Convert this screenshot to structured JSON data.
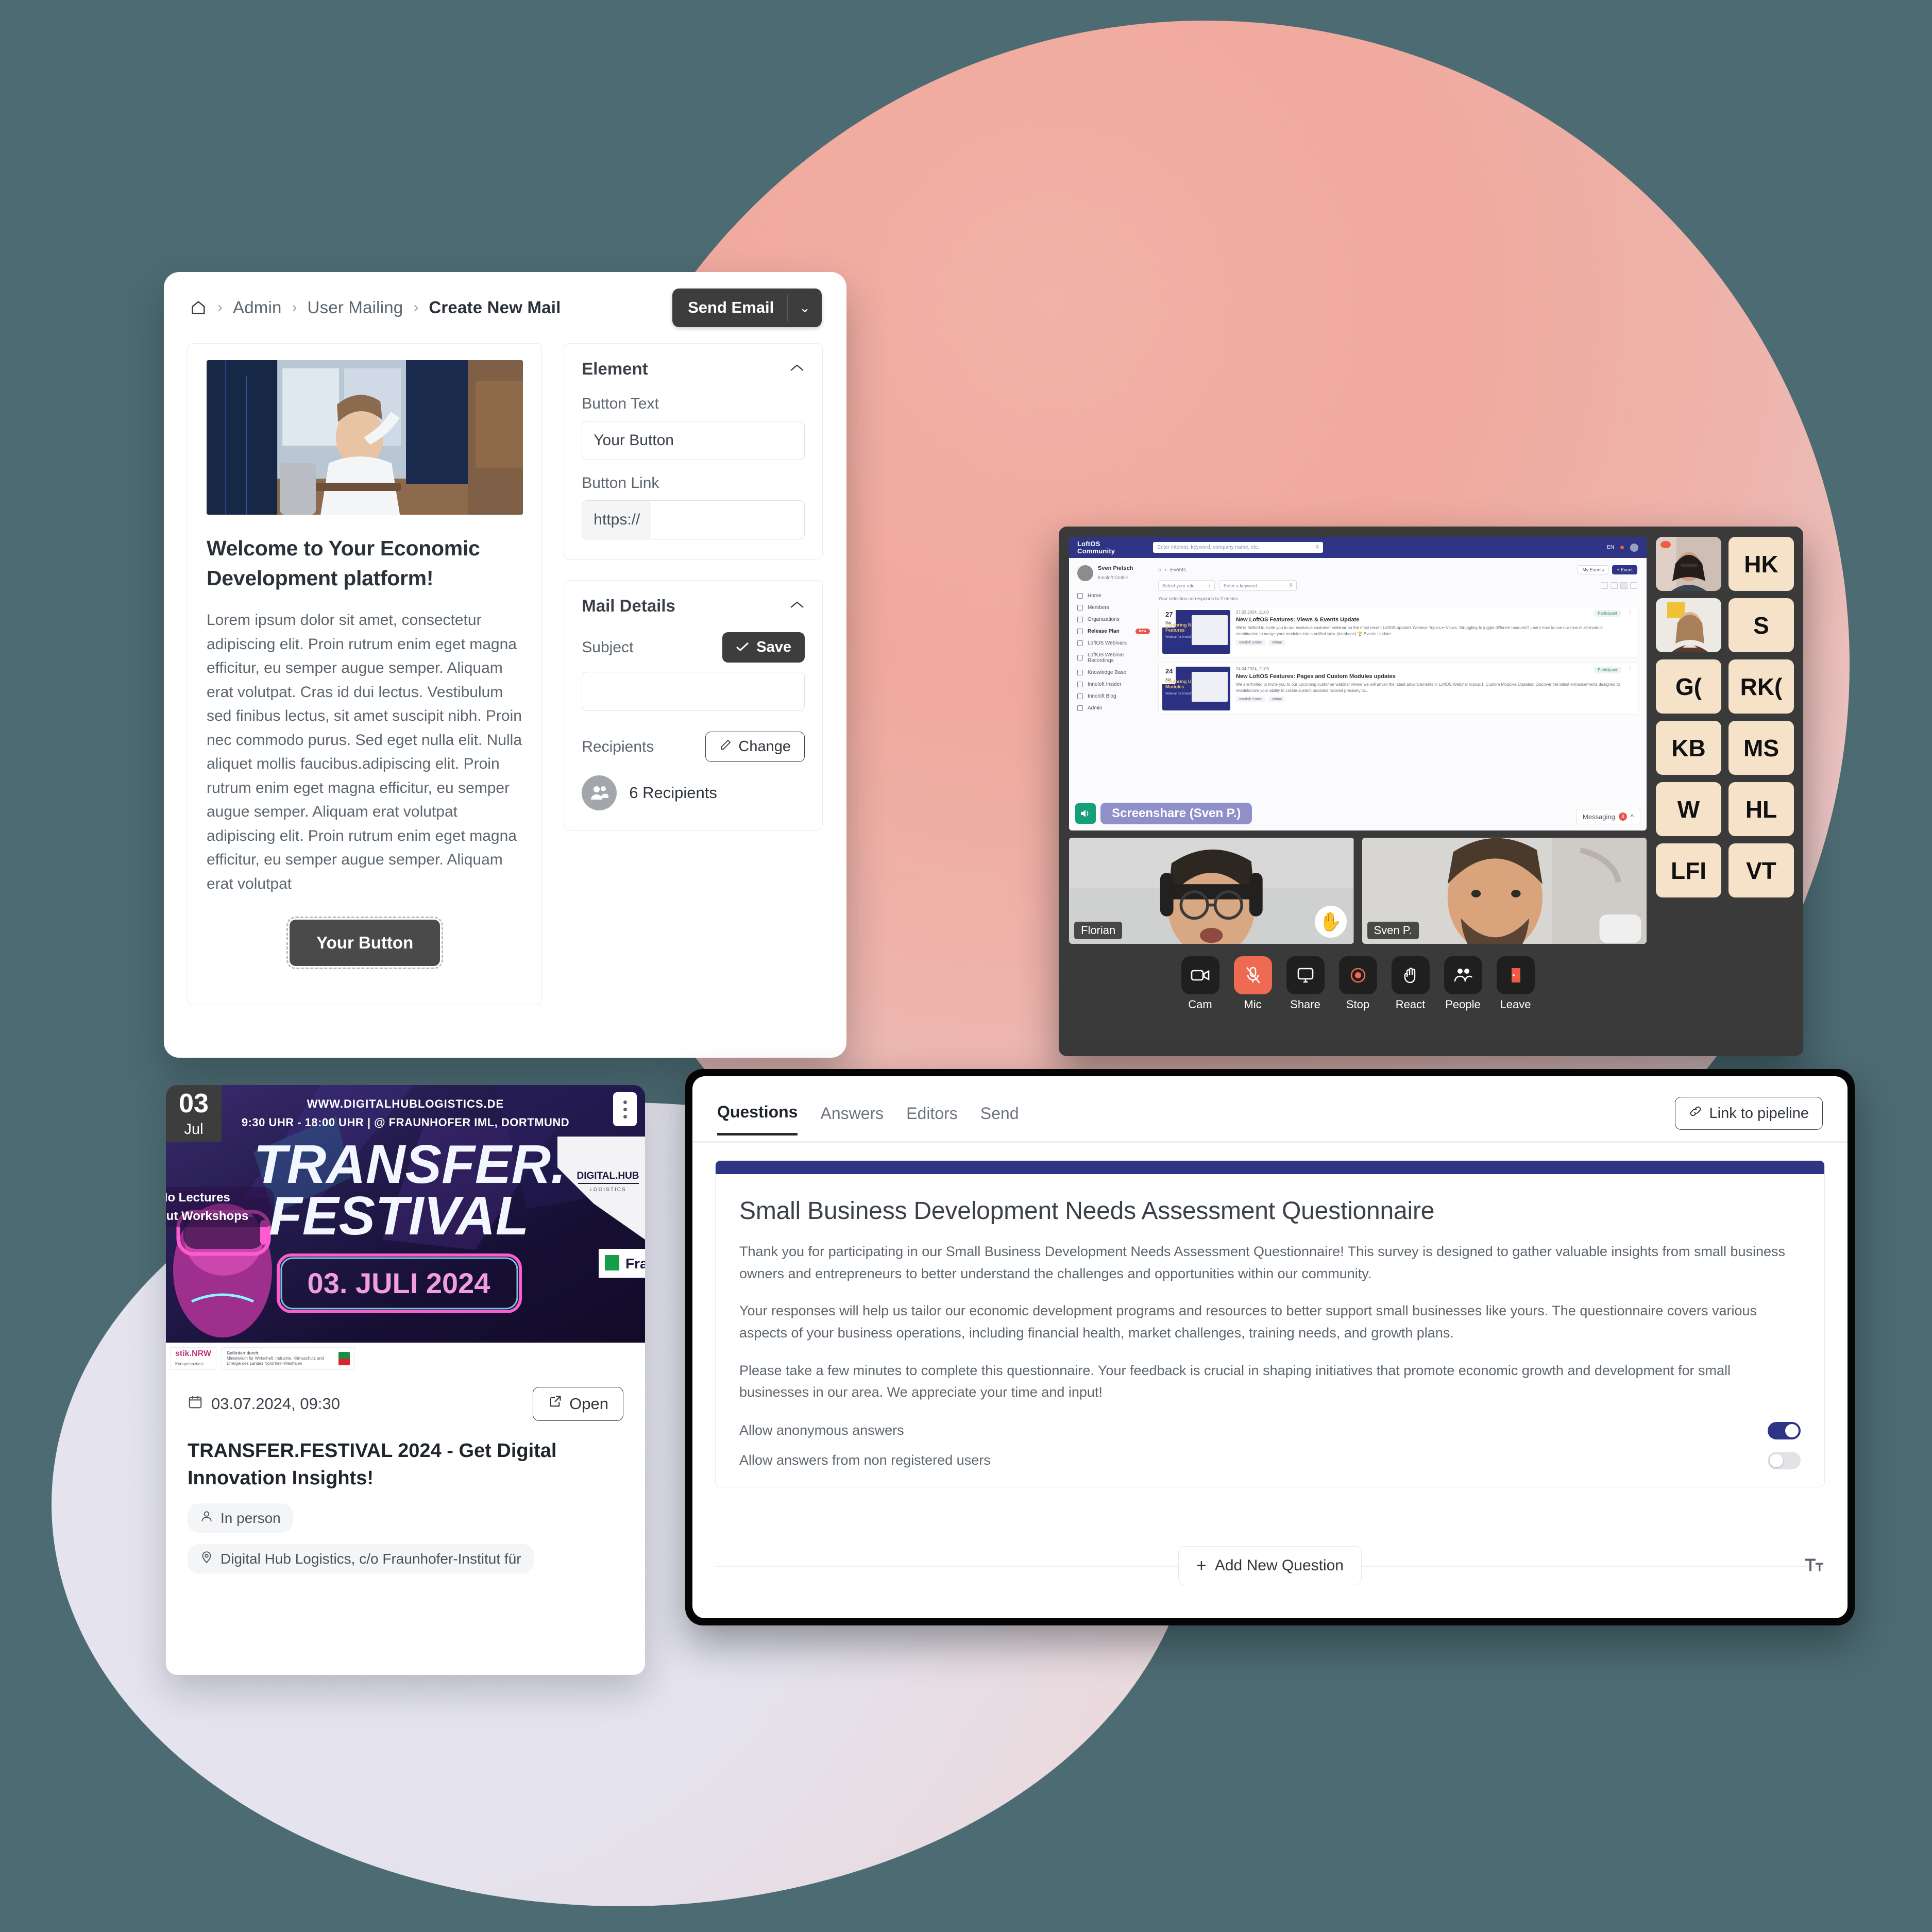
{
  "background": {
    "canvas_color": "#4d6b72",
    "blob_pink": "#f0a99d",
    "blob_lavender": "#e4e3ee"
  },
  "mail_window": {
    "breadcrumb": {
      "home_icon": "home-icon",
      "items": [
        "Admin",
        "User Mailing",
        "Create New Mail"
      ]
    },
    "send_button": {
      "label": "Send Email",
      "caret_icon": "chevron-down-icon"
    },
    "email_preview": {
      "heading": "Welcome to Your Economic Development platform!",
      "body": "Lorem ipsum dolor sit amet, consectetur adipiscing elit. Proin rutrum enim eget magna efficitur, eu semper augue semper. Aliquam erat volutpat. Cras id dui lectus. Vestibulum sed finibus lectus, sit amet suscipit nibh. Proin nec commodo purus. Sed eget nulla elit. Nulla aliquet mollis faucibus.adipiscing elit. Proin rutrum enim eget magna efficitur, eu semper augue semper. Aliquam erat volutpat adipiscing elit. Proin rutrum enim eget magna efficitur, eu semper augue semper. Aliquam erat volutpat",
      "cta_label": "Your Button"
    },
    "element_section": {
      "title": "Element",
      "collapse_icon": "chevron-up-icon",
      "button_text_label": "Button Text",
      "button_text_value": "Your Button",
      "button_link_label": "Button Link",
      "button_link_prefix": "https://",
      "button_link_value": ""
    },
    "mail_details_section": {
      "title": "Mail Details",
      "collapse_icon": "chevron-up-icon",
      "subject_label": "Subject",
      "subject_value": "",
      "save_label": "Save",
      "recipients_label": "Recipients",
      "change_label": "Change",
      "recipients_count": "6 Recipients"
    }
  },
  "video_call": {
    "screenshare": {
      "app_logo_line1": "LoftOS",
      "app_logo_line2": "Community",
      "search_placeholder": "Enter interest, keyword, company name, etc.",
      "lang": "EN",
      "user_name": "Sven Pietsch",
      "user_org": "Innoloft GmbH",
      "nav": [
        "Home",
        "Members",
        "Organizations",
        "Release Plan",
        "LoftOS Webinars",
        "LoftOS Webinar Recordings",
        "Knowledge Base",
        "Innoloft Insider",
        "Innoloft Blog",
        "Admin"
      ],
      "nav_active": "Release Plan",
      "nav_badge": "New",
      "breadcrumb": "Events",
      "my_events_label": "My Events",
      "add_event_label": "+ Event",
      "role_select_placeholder": "Select your role",
      "keyword_placeholder": "Enter a keyword...",
      "result_count_text": "Your selection corresponds to 2 entries",
      "events": [
        {
          "day": "27",
          "month": "Mar",
          "banner_title": "Exploring New LoftOS Features",
          "banner_sub": "Webinar for Innoloft customers",
          "date": "27.03.2024, 11:00",
          "status": "Participant",
          "title": "New LoftOS Features: Views & Events Update",
          "desc": "We're thrilled to invite you to our exclusive customer webinar on the most recent LoftOS updates.Webinar Topics:•• Views: Struggling to juggle different modules? Learn how to use our new multi-module combination to merge your modules into a unified view (database).🏆 Events Update:...",
          "tags": [
            "Innoloft GmbH",
            "Virtual"
          ]
        },
        {
          "day": "24",
          "month": "Apr",
          "banner_title": "Exploring Updated LoftOS Modules",
          "banner_sub": "Webinar for Innoloft customers",
          "date": "24.04.2024, 11:00",
          "status": "Participant",
          "title": "New LoftOS Features: Pages and Custom Modules updates",
          "desc": "We are thrilled to invite you to our upcoming customer webinar where we will unveil the latest advancements in LoftOS.Webinar topics:1. Custom Modules Updates: Discover the latest enhancements designed to revolutionize your ability to create custom modules tailored precisely to...",
          "tags": [
            "Innoloft GmbH",
            "Virtual"
          ]
        }
      ],
      "share_badge": "Screenshare (Sven P.)",
      "speaker_icon": "speaker-icon",
      "messaging_label": "Messaging",
      "messaging_count": "3"
    },
    "cam_tiles": [
      {
        "name": "Florian",
        "reaction": "✋"
      },
      {
        "name": "Sven P.",
        "reaction": ""
      }
    ],
    "controls": [
      {
        "label": "Cam",
        "icon": "camera-icon",
        "active": false
      },
      {
        "label": "Mic",
        "icon": "mic-muted-icon",
        "active": true
      },
      {
        "label": "Share",
        "icon": "screen-share-icon",
        "active": false
      },
      {
        "label": "Stop",
        "icon": "record-stop-icon",
        "active": false
      },
      {
        "label": "React",
        "icon": "raised-hand-icon",
        "active": false
      },
      {
        "label": "People",
        "icon": "people-icon",
        "active": false
      },
      {
        "label": "Leave",
        "icon": "leave-door-icon",
        "active": false
      }
    ],
    "participants": [
      "HK",
      "S",
      "G(",
      "RK(",
      "KB",
      "MS",
      "W",
      "HL",
      "LFI",
      "VT"
    ],
    "participant_accent": "#f6e2c8"
  },
  "event_card": {
    "date_day": "03",
    "date_month": "Jul",
    "banner": {
      "url": "WWW.DIGITALHUBLOGISTICS.DE",
      "time_place": "9:30 UHR - 18:00 UHR | @ FRAUNHOFER IML, DORTMUND",
      "title_line1": "TRANSFER.",
      "title_line2": "FESTIVAL",
      "date_badge": "03. JULI 2024",
      "sticker_line1": "No Lectures",
      "sticker_line2": "but Workshops",
      "logo_hub_line1": "DIGITAL.HUB",
      "logo_hub_line2": "LOGISTICS",
      "logo_fraunhofer": "Fra"
    },
    "logos": {
      "left_strong": "stik.NRW",
      "left_sub": "Kompetenznetz",
      "right_title": "Gefördert durch:",
      "right_text": "Ministerium für Wirtschaft, Industrie, Klimaschutz und Energie des Landes Nordrhein-Westfalen"
    },
    "datetime": "03.07.2024, 09:30",
    "calendar_icon": "calendar-icon",
    "open_label": "Open",
    "open_icon": "external-link-icon",
    "title": "TRANSFER.FESTIVAL 2024 - Get Digital Innovation Insights!",
    "chips": [
      {
        "icon": "person-icon",
        "label": "In person"
      },
      {
        "icon": "map-pin-icon",
        "label": "Digital Hub Logistics, c/o Fraunhofer-Institut für"
      }
    ]
  },
  "questionnaire": {
    "tabs": [
      "Questions",
      "Answers",
      "Editors",
      "Send"
    ],
    "active_tab": "Questions",
    "link_button": {
      "label": "Link to pipeline",
      "icon": "link-icon"
    },
    "accent_color": "#2f3584",
    "title": "Small Business Development Needs Assessment Questionnaire",
    "paragraphs": [
      "Thank you for participating in our Small Business Development Needs Assessment Questionnaire! This survey is designed to gather valuable insights from small business owners and entrepreneurs to better understand the challenges and opportunities within our community.",
      "Your responses will help us tailor our economic development programs and resources to better support small businesses like yours. The questionnaire covers various aspects of your business operations, including financial health, market challenges, training needs, and growth plans.",
      "Please take a few minutes to complete this questionnaire. Your feedback is crucial in shaping initiatives that promote economic growth and development for small businesses in our area. We appreciate your time and input!"
    ],
    "toggles": [
      {
        "label": "Allow anonymous answers",
        "on": true
      },
      {
        "label": "Allow answers from non registered users",
        "on": false
      }
    ],
    "add_question_label": "Add New Question",
    "add_question_icon": "plus-icon",
    "text_tool_icon": "text-size-icon"
  }
}
